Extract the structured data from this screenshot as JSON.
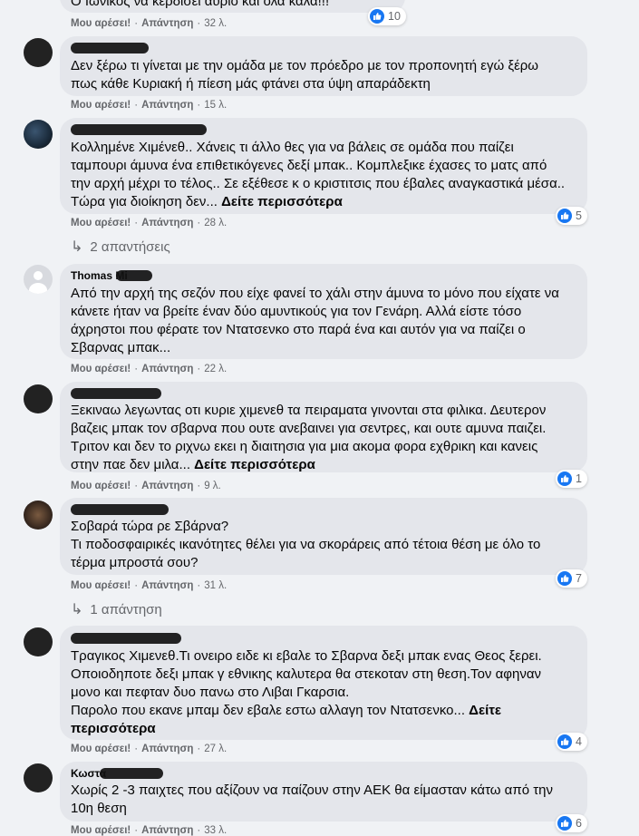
{
  "ui": {
    "like_label": "Μου αρέσει!",
    "reply_label": "Απάντηση",
    "see_more_label": "Δείτε περισσότερα",
    "separator": "·",
    "reply_arrow": "↳",
    "like_color": "#1877f2"
  },
  "comments": [
    {
      "text": "Ο Ιωνικός να κερδίσει αύριο και όλα καλά!!!",
      "time": "32 λ.",
      "reactions": "10"
    },
    {
      "author": "",
      "text": "Δεν ξέρω τι γίνεται με την ομάδα με τον πρόεδρο με τον προπονητή εγώ ξέρω\nπως κάθε Κυριακή ή πίεση μάς φτάνει στα ύψη απαράδεκτη",
      "time": "15 λ."
    },
    {
      "author": "",
      "text": "Κολλημένε Χιμένεθ.. Χάνεις τι άλλο θες για να βάλεις σε ομάδα που παίζει\nταμπουρι άμυνα ένα επιθετικόγενες δεξί μπακ.. Κομπλεξικε έχασες το ματς από\nτην αρχή μέχρι το τέλος.. Σε εξέθεσε κ ο κριστιτσις που έβαλες αναγκαστικά μέσα..\nΤώρα για διοίκηση δεν...",
      "see_more": true,
      "time": "28 λ.",
      "reactions": "5",
      "replies": "2 απαντήσεις"
    },
    {
      "author": "Thomas Mi",
      "text": "Από την αρχή της σεζόν που είχε φανεί το χάλι στην άμυνα το μόνο που είχατε να\nκάνετε ήταν να βρείτε έναν δύο αμυντικούς για τον Γενάρη. Αλλά είστε τόσο\nάχρηστοι που φέρατε τον Ντατσενκο στο παρά ένα και αυτόν για να παίζει ο\nΣβαρνας μπακ...",
      "time": "22 λ."
    },
    {
      "author": "",
      "text": "Ξεκιναω λεγωντας οτι κυριε χιμενεθ τα πειραματα γινονται στα φιλικα. Δευτερον\nβαζεις μπακ τον σβαρνα που ουτε ανεβαινει για σεντρες, και ουτε αμυνα παιζει.\nΤριτον και δεν το ριχνω εκει η διαιτησια για μια ακομα φορα εχθρικη και κανεις\nστην παε δεν μιλα...",
      "see_more": true,
      "time": "9 λ.",
      "reactions": "1"
    },
    {
      "author": "",
      "text": "Σοβαρά τώρα ρε Σβάρνα?\nΤι ποδοσφαιρικές ικανότητες θέλει για να σκοράρεις από τέτοια θέση με όλο το\nτέρμα μπροστά σου?",
      "time": "31 λ.",
      "reactions": "7",
      "replies": "1 απάντηση"
    },
    {
      "author": "",
      "text": "Τραγικος Χιμενεθ.Τι ονειρο ειδε κι εβαλε το Σβαρνα δεξι μπακ ενας Θεος ξερει.\nΟποιοδηποτε δεξι μπακ γ εθνικης καλυτερα θα στεκοταν στη θεση.Τον αφηναν\nμονο και πεφταν δυο πανω στο Λιβαι Γκαρσια.\nΠαρολο που εκανε μπαμ δεν εβαλε εστω αλλαγη τον Ντατσενκο...",
      "see_more": true,
      "see_more_text": "Δείτε\nπερισσότερα",
      "time": "27 λ.",
      "reactions": "4"
    },
    {
      "author": "Κωστα",
      "text": "Χωρίς 2 -3 παιχτες που αξίζουν να παίζουν στην ΑΕΚ θα είμασταν κάτω από την\n10η θεση",
      "time": "33 λ.",
      "reactions": "6"
    }
  ]
}
